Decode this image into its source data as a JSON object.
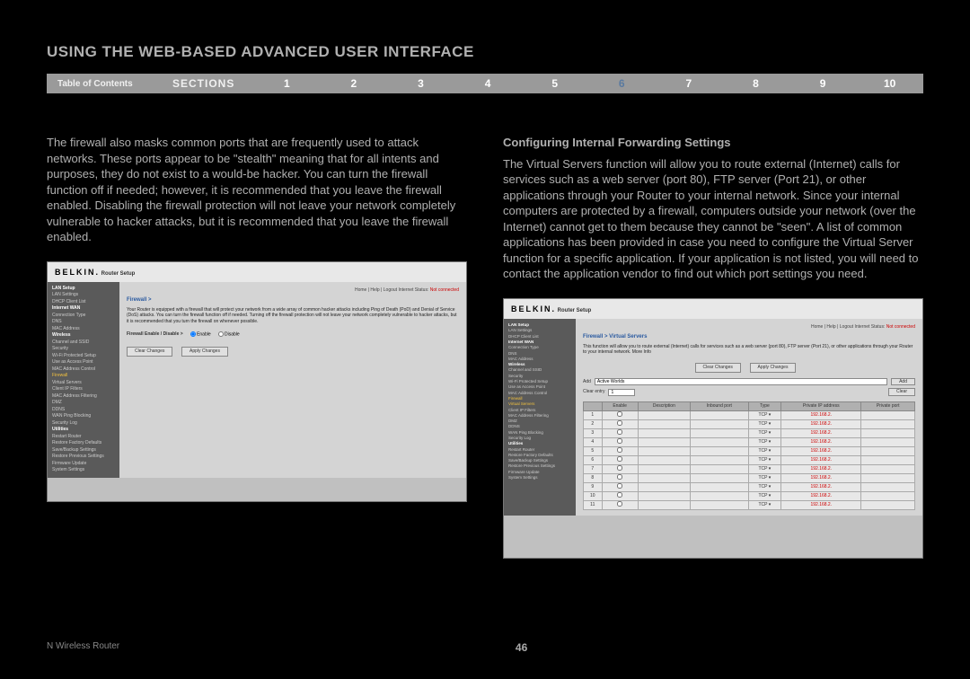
{
  "title": "USING THE WEB-BASED ADVANCED USER INTERFACE",
  "nav": {
    "toc": "Table of Contents",
    "sections": "SECTIONS",
    "nums": [
      "1",
      "2",
      "3",
      "4",
      "5",
      "6",
      "7",
      "8",
      "9",
      "10"
    ],
    "active": "6"
  },
  "left_para": "The firewall also masks common ports that are frequently used to attack networks. These ports appear to be \"stealth\" meaning that for all intents and purposes, they do not exist to a would-be hacker. You can turn the firewall function off if needed; however, it is recommended that you leave the firewall enabled. Disabling the firewall protection will not leave your network completely vulnerable to hacker attacks, but it is recommended that you leave the firewall enabled.",
  "right_heading": "Configuring Internal Forwarding Settings",
  "right_para": "The Virtual Servers function will allow you to route external (Internet) calls for services such as a web server (port 80), FTP server (Port 21), or other applications through your Router to your internal network. Since your internal computers are protected by a firewall, computers outside your network (over the Internet) cannot get to them because they cannot be \"seen\". A list of common applications has been provided in case you need to configure the Virtual Server function for a specific application. If your application is not listed, you will need to contact the application vendor to find out which port settings you need.",
  "ss_brand": "BELKIN.",
  "ss_setup": "Router Setup",
  "ss_top_links": "Home | Help | Logout   Internet Status:",
  "ss_not_connected": "Not connected",
  "ss1": {
    "side": [
      "LAN Setup",
      "LAN Settings",
      "DHCP Client List",
      "Internet WAN",
      "Connection Type",
      "DNS",
      "MAC Address",
      "Wireless",
      "Channel and SSID",
      "Security",
      "Wi-Fi Protected Setup",
      "Use as Access Point",
      "MAC Address Control",
      "Firewall",
      "Virtual Servers",
      "Client IP Filters",
      "MAC Address Filtering",
      "DMZ",
      "DDNS",
      "WAN Ping Blocking",
      "Security Log",
      "Utilities",
      "Restart Router",
      "Restore Factory Defaults",
      "Save/Backup Settings",
      "Restore Previous Settings",
      "Firmware Update",
      "System Settings"
    ],
    "crumb": "Firewall >",
    "desc": "Your Router is equipped with a firewall that will protect your network from a wide array of common hacker attacks including Ping of Death (PoD) and Denial of Service (DoS) attacks. You can turn the firewall function off if needed. Turning off the firewall protection will not leave your network completely vulnerable to hacker attacks, but it is recommended that you turn the firewall on whenever possible.",
    "enable_label": "Firewall Enable / Disable >",
    "radio_enable": "Enable",
    "radio_disable": "Disable",
    "btn_clear": "Clear Changes",
    "btn_apply": "Apply Changes"
  },
  "ss2": {
    "crumb": "Firewall > Virtual Servers",
    "desc": "This function will allow you to route external (Internet) calls for services such as a web server (port 80), FTP server (Port 21), or other applications through your Router to your internal network. More Info",
    "btn_clear": "Clear Changes",
    "btn_apply": "Apply Changes",
    "add_label": "Add",
    "add_value": "Active Worlds",
    "add_btn": "Add",
    "clear_label": "Clear entry",
    "clear_btn": "Clear",
    "headers": [
      "",
      "Enable",
      "Description",
      "Inbound port",
      "Type",
      "Private IP address",
      "Private port"
    ],
    "rows": [
      {
        "n": "1",
        "type": "TCP",
        "ip": "192.168.2."
      },
      {
        "n": "2",
        "type": "TCP",
        "ip": "192.168.2."
      },
      {
        "n": "3",
        "type": "TCP",
        "ip": "192.168.2."
      },
      {
        "n": "4",
        "type": "TCP",
        "ip": "192.168.2."
      },
      {
        "n": "5",
        "type": "TCP",
        "ip": "192.168.2."
      },
      {
        "n": "6",
        "type": "TCP",
        "ip": "192.168.2."
      },
      {
        "n": "7",
        "type": "TCP",
        "ip": "192.168.2."
      },
      {
        "n": "8",
        "type": "TCP",
        "ip": "192.168.2."
      },
      {
        "n": "9",
        "type": "TCP",
        "ip": "192.168.2."
      },
      {
        "n": "10",
        "type": "TCP",
        "ip": "192.168.2."
      },
      {
        "n": "11",
        "type": "TCP",
        "ip": "192.168.2."
      }
    ]
  },
  "footer_left": "N Wireless Router",
  "footer_page": "46"
}
